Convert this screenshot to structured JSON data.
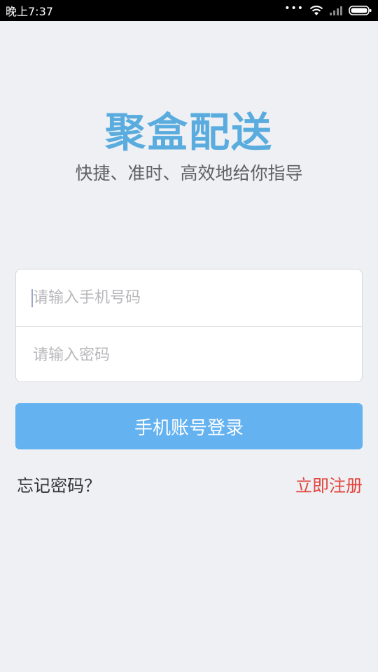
{
  "status_bar": {
    "time": "晚上7:37",
    "dots": "•••",
    "icons": [
      "wifi-icon",
      "signal-icon",
      "battery-icon"
    ]
  },
  "header": {
    "title": "聚盒配送",
    "subtitle": "快捷、准时、高效地给你指导"
  },
  "form": {
    "phone": {
      "value": "",
      "placeholder": "请输入手机号码"
    },
    "password": {
      "value": "",
      "placeholder": "请输入密码"
    }
  },
  "actions": {
    "login_label": "手机账号登录",
    "forgot_label": "忘记密码？",
    "register_label": "立即注册"
  },
  "colors": {
    "title": "#5aacdf",
    "button": "#64b2f0",
    "register": "#e2453d",
    "background": "#eef0f4"
  }
}
